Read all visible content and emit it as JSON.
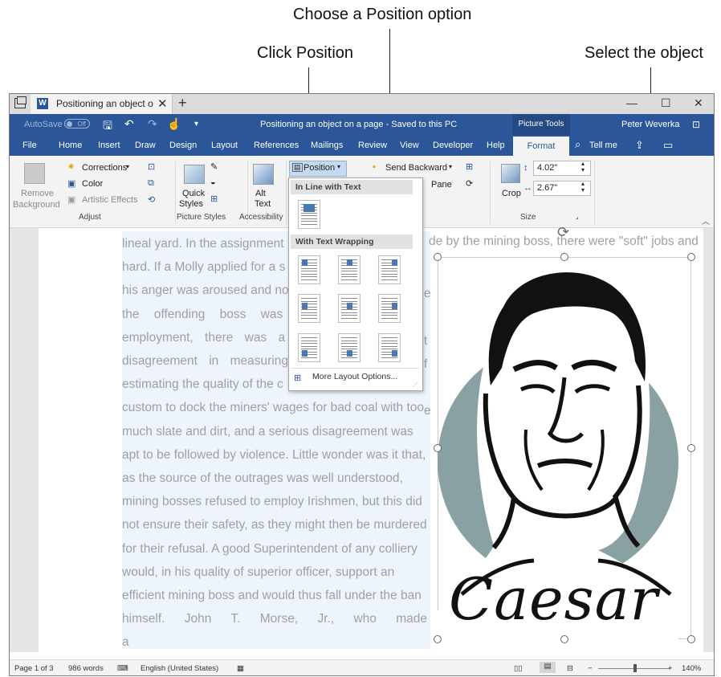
{
  "callouts": {
    "choose_position": "Choose a Position option",
    "click_position": "Click Position",
    "select_object": "Select the object"
  },
  "window": {
    "tab_title": "Positioning an object o",
    "doc_title": "Positioning an object on a page - Saved to this PC",
    "autosave_label": "AutoSave",
    "autosave_state": "Off",
    "picture_tools": "Picture Tools",
    "user": "Peter Weverka",
    "controls": [
      "—",
      "☐",
      "✕"
    ]
  },
  "ribbon_tabs": [
    "File",
    "Home",
    "Insert",
    "Draw",
    "Design",
    "Layout",
    "References",
    "Mailings",
    "Review",
    "View",
    "Developer",
    "Help"
  ],
  "active_tab": "Format",
  "tell_me": "Tell me",
  "ribbon": {
    "remove_background": [
      "Remove",
      "Background"
    ],
    "corrections": "Corrections",
    "color": "Color",
    "artistic_effects": "Artistic Effects",
    "adjust": "Adjust",
    "quick_styles": [
      "Quick",
      "Styles"
    ],
    "picture_styles": "Picture Styles",
    "alt_text": [
      "Alt",
      "Text"
    ],
    "accessibility": "Accessibility",
    "position": "Position",
    "send_backward": "Send Backward",
    "pane": "Pane",
    "crop": "Crop",
    "height": "4.02\"",
    "width": "2.67\"",
    "size": "Size"
  },
  "position_menu": {
    "inline_header": "In Line with Text",
    "wrap_header": "With Text Wrapping",
    "more_options": "More Layout Options..."
  },
  "document": {
    "top_line": "lineal yard. In the assignment",
    "top_line_right": "de by the mining boss, there were \"soft\" jobs and",
    "lines": [
      "hard. If a Molly applied for a s",
      "his anger was aroused and no",
      "the offending boss was",
      "employment, there was a",
      "disagreement in measuring",
      "estimating the quality of the c",
      "custom to dock the miners' wages for bad coal with too",
      "much slate and dirt, and a serious disagreement was",
      "apt to be followed by violence. Little wonder was it that,",
      "as the source of the outrages was well understood,",
      "mining bosses refused to employ Irishmen, but this did",
      "not ensure their safety, as they might then be murdered",
      "for their refusal. A good Superintendent of any colliery",
      "would, in his quality of superior officer, support an",
      "efficient mining boss and would thus fall under the ban",
      "himself. John T. Morse, Jr., who made a"
    ],
    "right_fragments": {
      "2": "e",
      "4": "t",
      "5": "f",
      "7": "e"
    },
    "picture_caption": "Caesar"
  },
  "status": {
    "page": "Page 1 of 3",
    "words": "986 words",
    "language": "English (United States)",
    "zoom": "140%"
  },
  "colors": {
    "word_blue": "#2b579a",
    "bust_circle": "#8aa1a3"
  }
}
